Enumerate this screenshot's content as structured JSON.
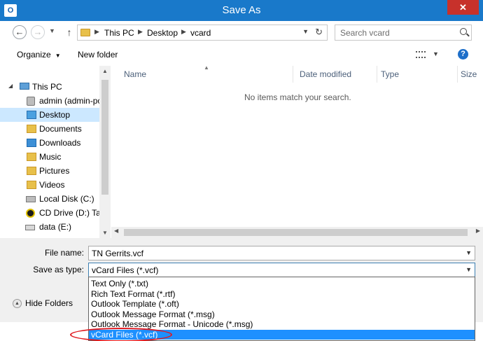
{
  "window": {
    "title": "Save As",
    "app_icon": "O",
    "close_label": "✕"
  },
  "address": {
    "crumbs": [
      "This PC",
      "Desktop",
      "vcard"
    ],
    "search_placeholder": "Search vcard"
  },
  "toolbar": {
    "organize_label": "Organize",
    "new_folder_label": "New folder"
  },
  "nav": {
    "items": [
      {
        "label": "This PC",
        "icon": "pc-icon"
      },
      {
        "label": "admin (admin-pc)",
        "icon": "user-icon"
      },
      {
        "label": "Desktop",
        "icon": "desktop-icon"
      },
      {
        "label": "Documents",
        "icon": "folder-icon"
      },
      {
        "label": "Downloads",
        "icon": "downloads-icon"
      },
      {
        "label": "Music",
        "icon": "music-icon"
      },
      {
        "label": "Pictures",
        "icon": "pictures-icon"
      },
      {
        "label": "Videos",
        "icon": "videos-icon"
      },
      {
        "label": "Local Disk (C:)",
        "icon": "disk-icon"
      },
      {
        "label": "CD Drive (D:) Tat",
        "icon": "cd-icon"
      },
      {
        "label": "data (E:)",
        "icon": "drive-icon"
      }
    ]
  },
  "files": {
    "columns": [
      "Name",
      "Date modified",
      "Type",
      "Size"
    ],
    "empty_message": "No items match your search."
  },
  "form": {
    "filename_label": "File name:",
    "filename_value": "TN Gerrits.vcf",
    "savetype_label": "Save as type:",
    "savetype_value": "vCard Files (*.vcf)",
    "hide_folders_label": "Hide Folders"
  },
  "dropdown": {
    "options": [
      "Text Only (*.txt)",
      "Rich Text Format (*.rtf)",
      "Outlook Template (*.oft)",
      "Outlook Message Format (*.msg)",
      "Outlook Message Format - Unicode (*.msg)",
      "vCard Files (*.vcf)"
    ],
    "selected_index": 5
  },
  "colors": {
    "titlebar": "#1979ca",
    "close": "#c7312b",
    "selection": "#1e90ff",
    "annotation": "#e0191f"
  }
}
